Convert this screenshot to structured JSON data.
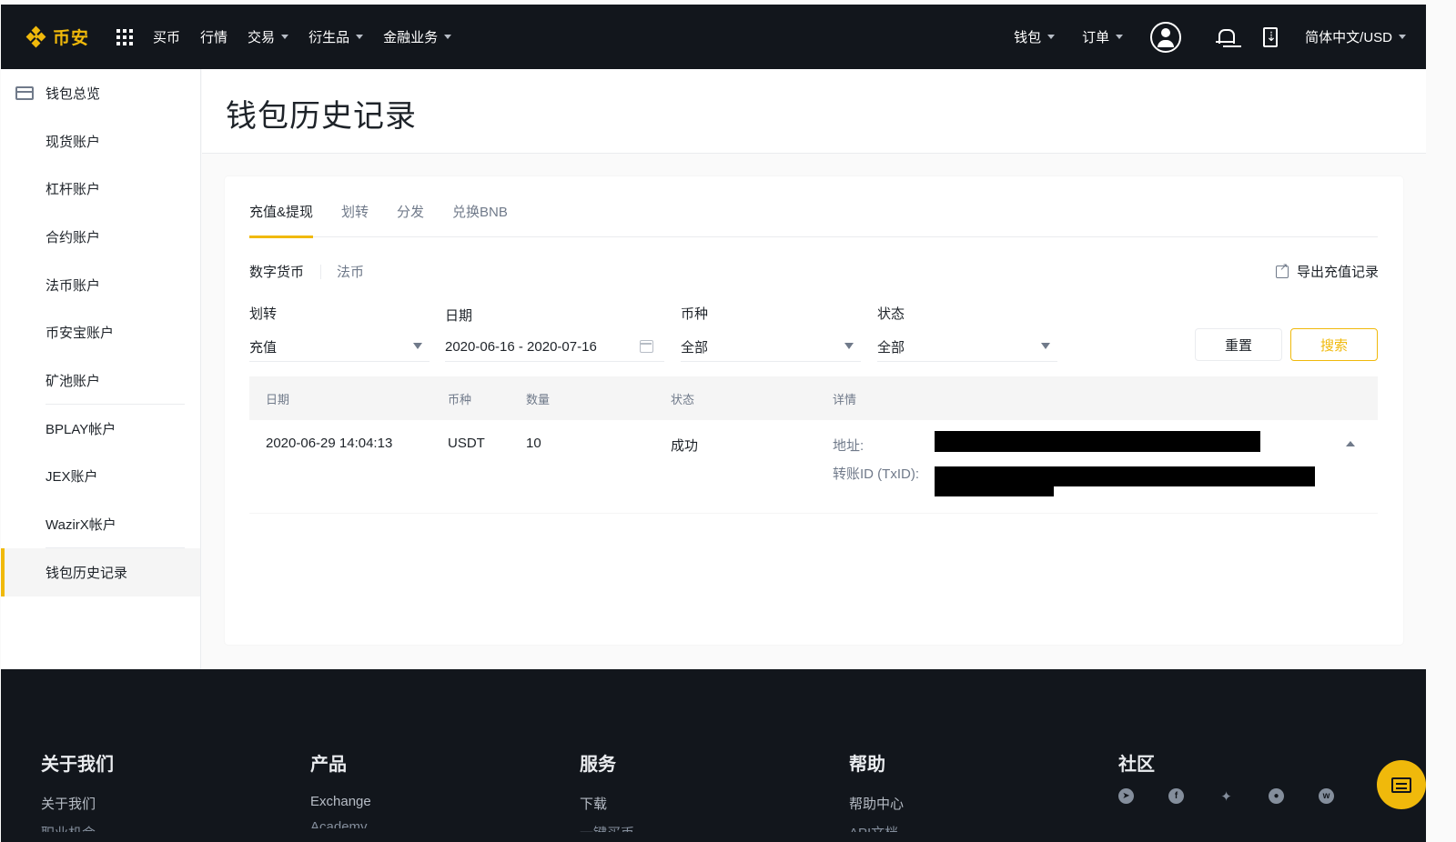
{
  "brand": {
    "name": "币安",
    "accent": "#f0b90b"
  },
  "nav": {
    "items": [
      {
        "label": "买币",
        "caret": false
      },
      {
        "label": "行情",
        "caret": false
      },
      {
        "label": "交易",
        "caret": true
      },
      {
        "label": "衍生品",
        "caret": true
      },
      {
        "label": "金融业务",
        "caret": true
      }
    ],
    "right": {
      "wallet": "钱包",
      "orders": "订单",
      "language": "简体中文/USD"
    },
    "icons": [
      "apps-grid-icon",
      "user-avatar-icon",
      "notification-bell-icon",
      "download-app-icon"
    ]
  },
  "sidebar": {
    "items": [
      {
        "label": "钱包总览"
      },
      {
        "label": "现货账户"
      },
      {
        "label": "杠杆账户"
      },
      {
        "label": "合约账户"
      },
      {
        "label": "法币账户"
      },
      {
        "label": "币安宝账户"
      },
      {
        "label": "矿池账户"
      },
      {
        "label": "BPLAY帐户"
      },
      {
        "label": "JEX账户"
      },
      {
        "label": "WazirX帐户"
      },
      {
        "label": "钱包历史记录"
      }
    ],
    "active": "钱包历史记录"
  },
  "page": {
    "title": "钱包历史记录"
  },
  "tabs": [
    "充值&提现",
    "划转",
    "分发",
    "兑换BNB"
  ],
  "subtabs": [
    "数字货币",
    "法币"
  ],
  "export_label": "导出充值记录",
  "filters": {
    "type": {
      "label": "划转",
      "value": "充值"
    },
    "date": {
      "label": "日期",
      "value": "2020-06-16 - 2020-07-16"
    },
    "coin": {
      "label": "币种",
      "value": "全部"
    },
    "status": {
      "label": "状态",
      "value": "全部"
    },
    "reset_label": "重置",
    "search_label": "搜索"
  },
  "table": {
    "columns": [
      "日期",
      "币种",
      "数量",
      "状态",
      "详情"
    ],
    "rows": [
      {
        "date": "2020-06-29 14:04:13",
        "coin": "USDT",
        "amount": "10",
        "status": "成功",
        "address_label": "地址:",
        "txid_label": "转账ID (TxID):"
      }
    ]
  },
  "footer": {
    "columns": [
      {
        "title": "关于我们",
        "link": "关于我们",
        "link2": "职业机会"
      },
      {
        "title": "产品",
        "link": "Exchange",
        "link2": "Academy"
      },
      {
        "title": "服务",
        "link": "下载",
        "link2": "一键买币"
      },
      {
        "title": "帮助",
        "link": "帮助中心",
        "link2": "API文档"
      },
      {
        "title": "社区",
        "link": "",
        "link2": ""
      }
    ],
    "social_icons": [
      "telegram-icon",
      "facebook-icon",
      "twitter-icon",
      "reddit-icon",
      "weibo-icon"
    ]
  }
}
